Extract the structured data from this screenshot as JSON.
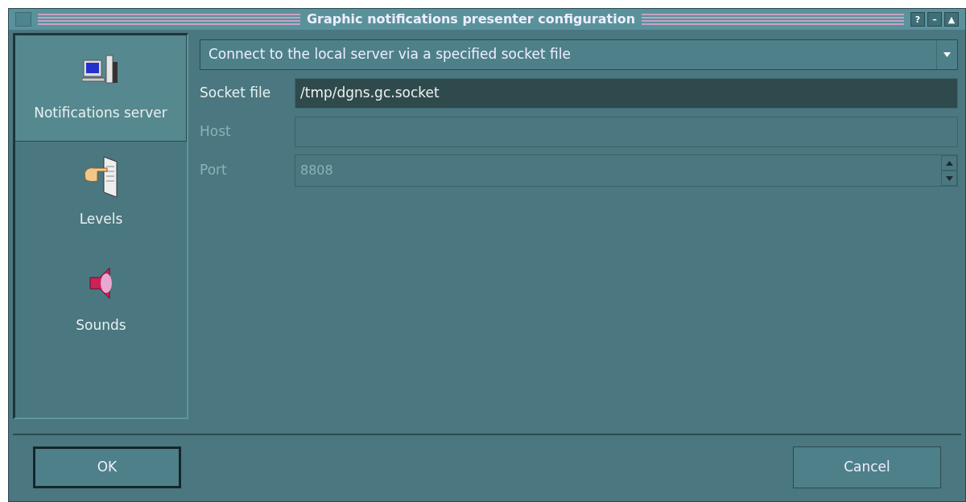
{
  "window": {
    "title": "Graphic notifications presenter configuration",
    "controls": [
      "?",
      "–",
      "▲"
    ]
  },
  "sidebar": {
    "items": [
      {
        "label": "Notifications server",
        "selected": true
      },
      {
        "label": "Levels",
        "selected": false
      },
      {
        "label": "Sounds",
        "selected": false
      }
    ]
  },
  "connection": {
    "value": "Connect to the local server via a specified socket file"
  },
  "fields": [
    {
      "label": "Socket file",
      "kind": "text",
      "value": "/tmp/dgns.gc.socket",
      "disabled": false
    },
    {
      "label": "Host",
      "kind": "text",
      "disabled": true
    },
    {
      "label": "Port",
      "kind": "spin",
      "value": "8808",
      "disabled": true
    }
  ],
  "buttons": [
    {
      "label": "OK",
      "focused": true
    },
    {
      "label": "Cancel",
      "focused": false
    }
  ]
}
